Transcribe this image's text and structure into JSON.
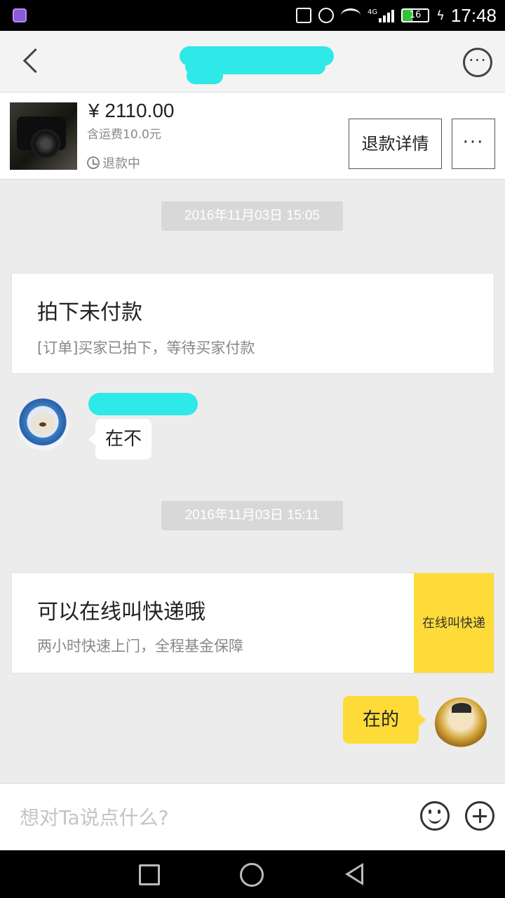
{
  "status_bar": {
    "network": "4G",
    "battery": "16",
    "time": "17:48"
  },
  "nav": {
    "title": "",
    "more_symbol": "···"
  },
  "product": {
    "price": "¥ 2110.00",
    "shipping": "含运费10.0元",
    "status": "退款中",
    "refund_button": "退款详情",
    "more_symbol": "···"
  },
  "messages": {
    "time_1": "2016年11月03日 15:05",
    "order_card": {
      "title": "拍下未付款",
      "subtitle": "[订单]买家已拍下，等待买家付款"
    },
    "buyer_message": "在不",
    "time_2": "2016年11月03日 15:11",
    "courier_card": {
      "title": "可以在线叫快递哦",
      "subtitle": "两小时快速上门，全程基金保障",
      "action": "在线叫快递"
    },
    "seller_message": "在的"
  },
  "input": {
    "placeholder": "想对Ta说点什么?"
  },
  "colors": {
    "accent_yellow": "#fedb38",
    "redaction_cyan": "#2fe8e8",
    "timestamp_gray": "#d8d8d8"
  }
}
